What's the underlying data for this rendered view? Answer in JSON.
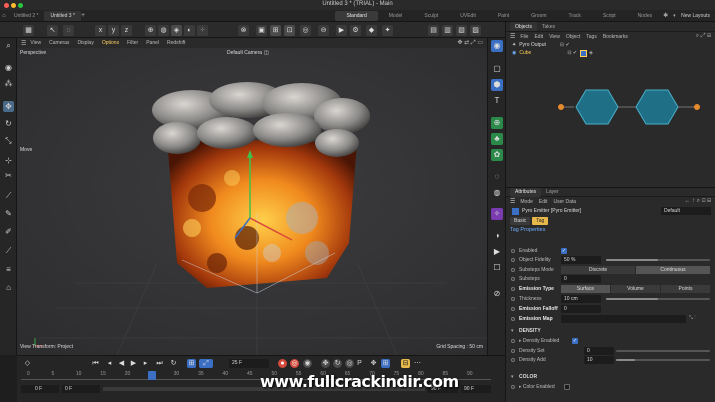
{
  "window": {
    "title": "Untitled 3 * (TRIAL) - Main",
    "traffic_lights": [
      "#ff5f57",
      "#febc2e",
      "#28c840"
    ]
  },
  "doc_tabs": [
    "Untitled 2 *",
    "Untitled 3 *"
  ],
  "layout_tabs": [
    "Standard",
    "Model",
    "Sculpt",
    "UVEdit",
    "Paint",
    "Groom",
    "Track",
    "Script",
    "Nodes"
  ],
  "new_layouts_label": "New Layouts",
  "viewport_menu": [
    "View",
    "Cameras",
    "Display",
    "Options",
    "Filter",
    "Panel",
    "Redshift"
  ],
  "viewport": {
    "label": "Perspective",
    "camera_label": "Default Camera",
    "camera_icon": "camera-icon",
    "move_label": "Move",
    "status_left": "View Transform: Project",
    "status_right": "Grid Spacing : 50 cm"
  },
  "timeline": {
    "current_frame": "25 F",
    "start_frame": "0 F",
    "start_frame_2": "0 F",
    "end_frame": "90 F",
    "end_frame_2": "90 F",
    "ruler_ticks": [
      "0",
      "5",
      "10",
      "15",
      "20",
      "25",
      "30",
      "35",
      "40",
      "45",
      "50",
      "55",
      "60",
      "65",
      "70",
      "75",
      "80",
      "85",
      "90"
    ]
  },
  "objects_panel": {
    "tabs": [
      "Objects",
      "Takes"
    ],
    "menu": [
      "File",
      "Edit",
      "View",
      "Object",
      "Tags",
      "Bookmarks"
    ],
    "items": [
      {
        "name": "Pyro Output",
        "color": "#ffffff"
      },
      {
        "name": "Cube",
        "color": "#ffcf5a"
      }
    ]
  },
  "attributes_panel": {
    "tabs": [
      "Attributes",
      "Layer"
    ],
    "menu": [
      "Mode",
      "Edit",
      "User Data"
    ],
    "object_title": "Pyro Emitter [Pyro Emitter]",
    "preset": "Default",
    "subtabs": [
      "Basic",
      "Tag"
    ],
    "section_title": "Tag Properties",
    "rows": {
      "enabled": "Enabled",
      "object_fidelity": "Object Fidelity",
      "object_fidelity_value": "50 %",
      "object_fidelity_fraction": 0.5,
      "substeps_mode": "Substeps Mode",
      "substeps_mode_options": [
        "Discrete",
        "Continuous"
      ],
      "substeps": "Substeps",
      "substeps_value": "0",
      "emission_type": "Emission Type",
      "emission_type_options": [
        "Surface",
        "Volume",
        "Points"
      ],
      "thickness": "Thickness",
      "thickness_value": "10 cm",
      "thickness_fraction": 0.5,
      "emission_falloff": "Emission Falloff",
      "emission_falloff_value": "0",
      "emission_map": "Emission Map"
    },
    "density_section": "DENSITY",
    "density_rows": {
      "enabled": "Density Enabled",
      "set": "Density Set",
      "set_value": "0",
      "add": "Density Add",
      "add_value": "10"
    },
    "color_section": "COLOR",
    "color_enabled": "Color Enabled"
  },
  "watermark": "www.fullcrackindir.com",
  "colors": {
    "accent_blue": "#3b6fc4",
    "selection_yellow": "#ffcf5a",
    "node_teal": "#1f6f86",
    "node_orange": "#e68a2e"
  }
}
